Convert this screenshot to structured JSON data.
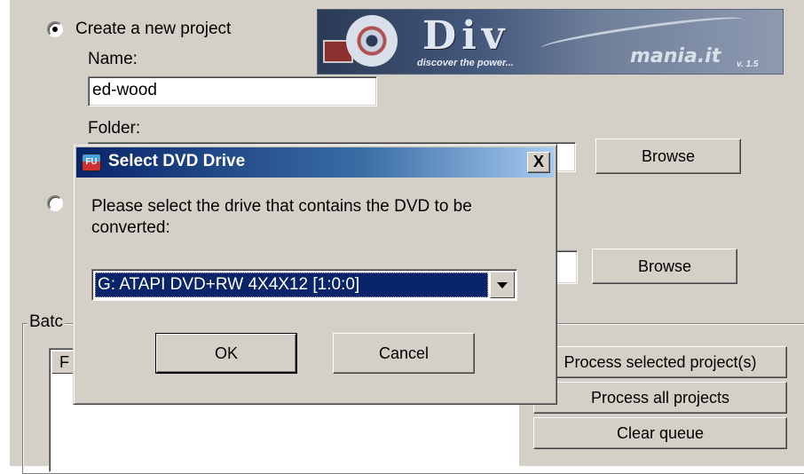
{
  "project": {
    "create_new_label": "Create a new project",
    "name_label": "Name:",
    "name_value": "ed-wood",
    "folder_label": "Folder:",
    "browse_label": "Browse",
    "browse2_label": "Browse"
  },
  "banner": {
    "logo_text": "Div",
    "tagline": "discover the power...",
    "site": "mania.it",
    "version": "v. 1.5"
  },
  "batch": {
    "group_label": "Batc",
    "list_header": "F",
    "process_selected_label": "Process selected project(s)",
    "process_all_label": "Process all projects",
    "clear_queue_label": "Clear queue"
  },
  "dialog": {
    "title": "Select DVD Drive",
    "close_label": "X",
    "icon_text": "FU",
    "message": "Please select the drive that contains the DVD to be converted:",
    "drive_selected": "G: ATAPI DVD+RW 4X4X12 [1:0:0]",
    "ok_label": "OK",
    "cancel_label": "Cancel"
  }
}
